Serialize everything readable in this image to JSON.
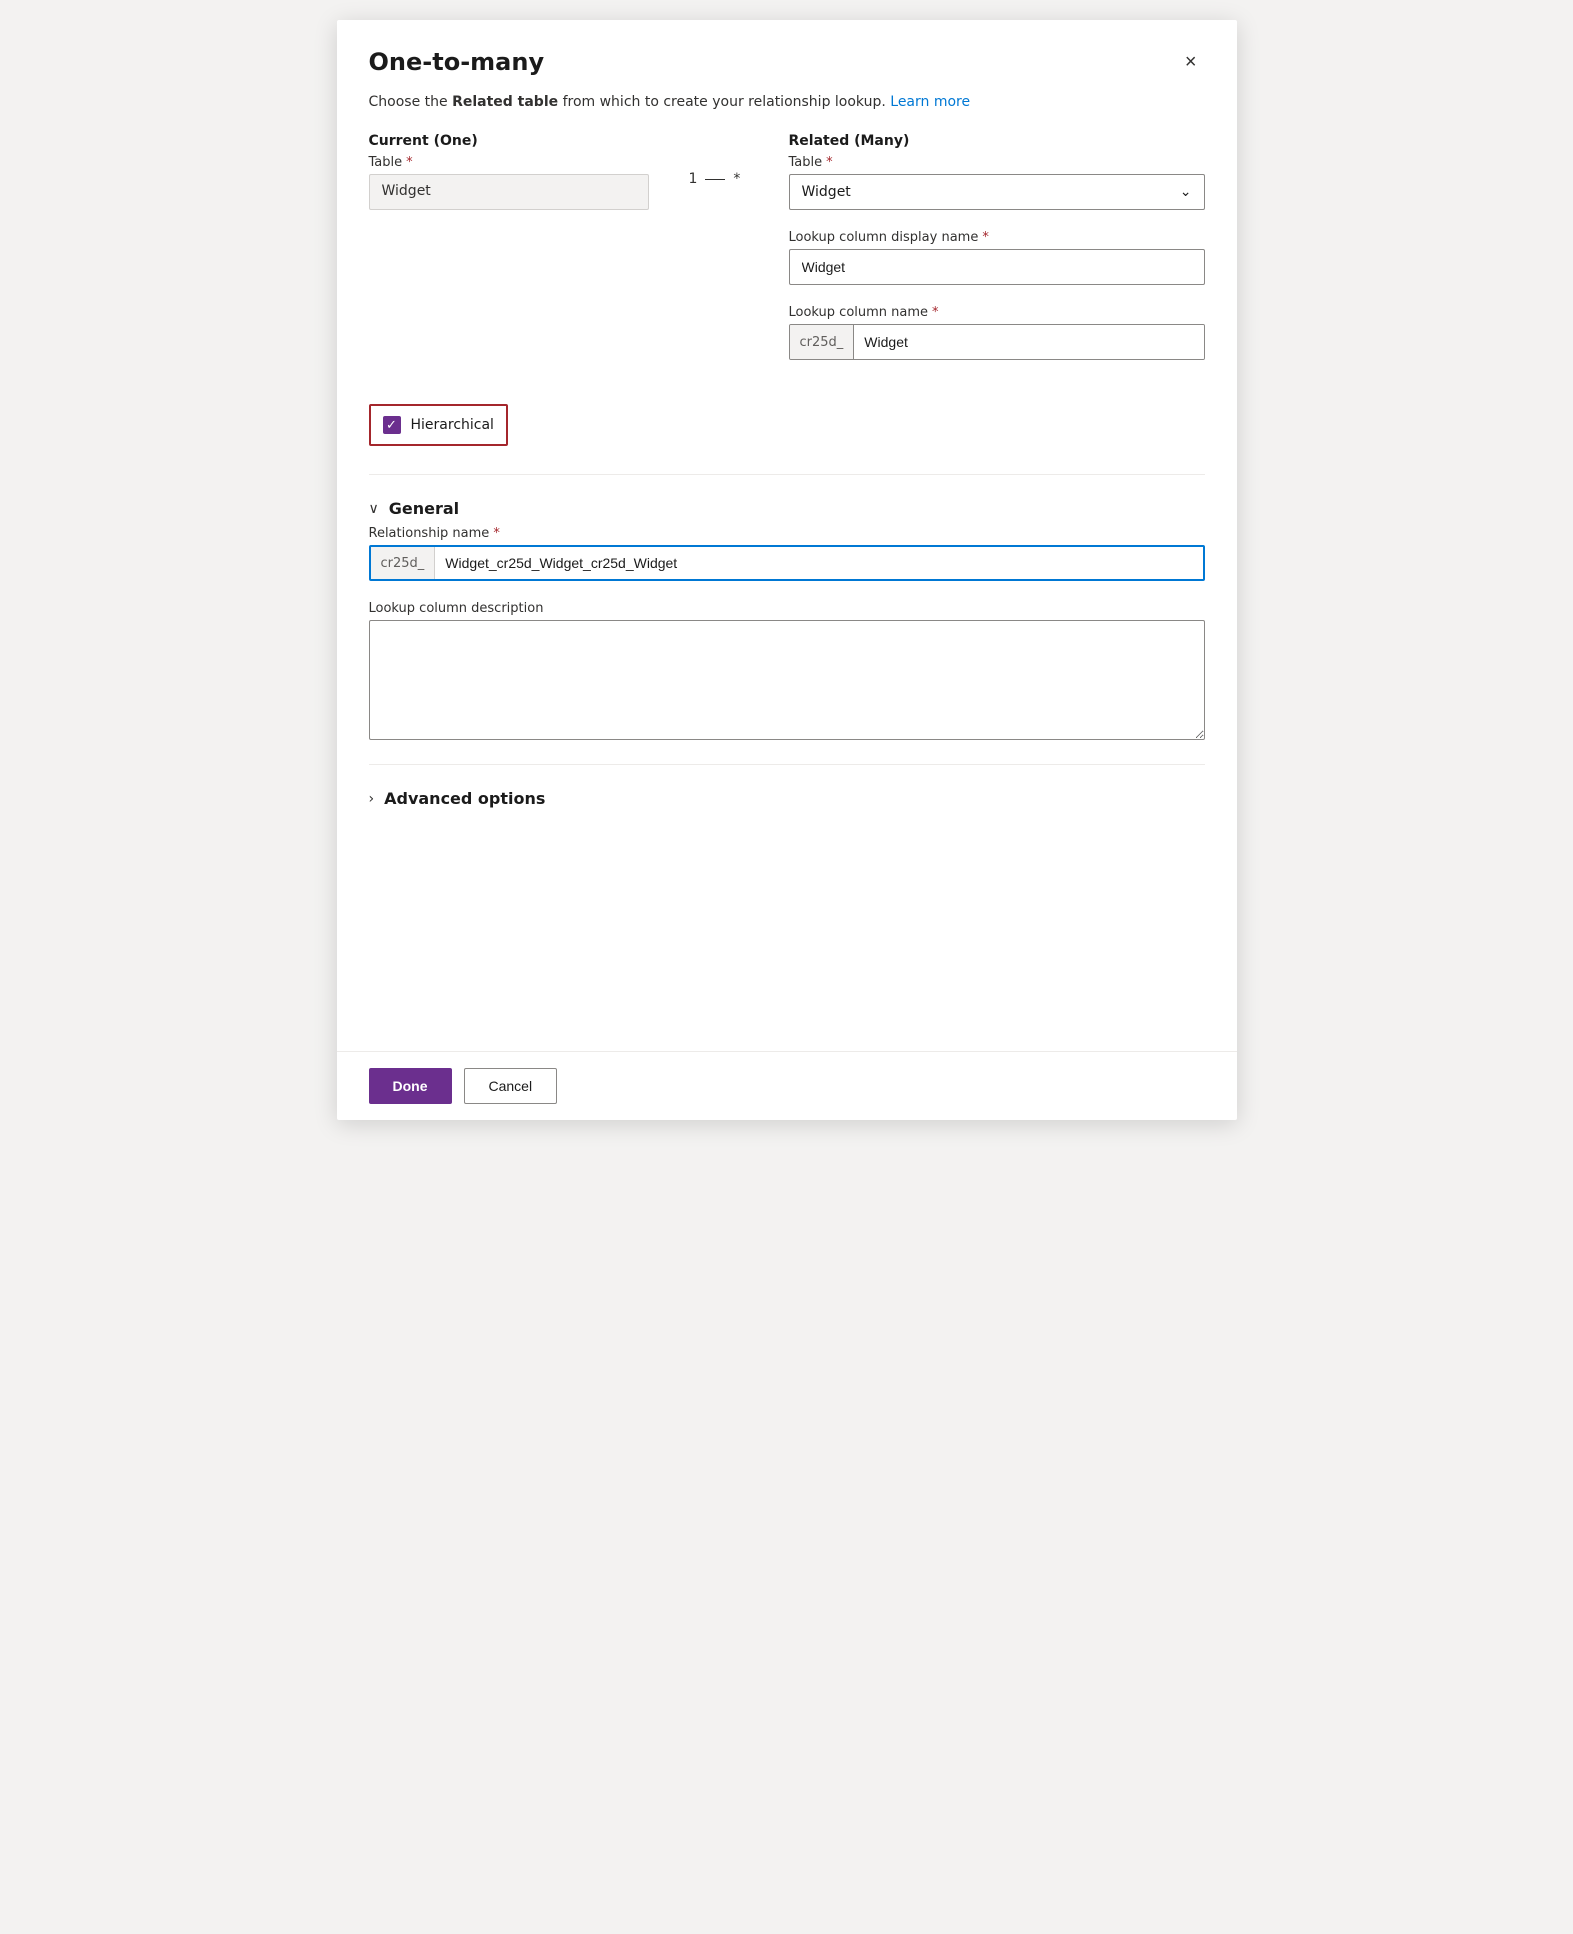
{
  "dialog": {
    "title": "One-to-many",
    "close_label": "×",
    "description_text": "Choose the ",
    "description_bold": "Related table",
    "description_after": " from which to create your relationship lookup.",
    "learn_more": "Learn more"
  },
  "current_section": {
    "label": "Current (One)",
    "table_label": "Table",
    "required": "*",
    "table_value": "Widget"
  },
  "connector": {
    "one": "1",
    "dash": "—",
    "many": "*"
  },
  "related_section": {
    "label": "Related (Many)",
    "table_label": "Table",
    "required": "*",
    "table_value": "Widget",
    "lookup_display_label": "Lookup column display name",
    "lookup_display_required": "*",
    "lookup_display_value": "Widget",
    "lookup_name_label": "Lookup column name",
    "lookup_name_required": "*",
    "lookup_name_prefix": "cr25d_",
    "lookup_name_value": "Widget"
  },
  "hierarchical": {
    "label": "Hierarchical",
    "checked": true
  },
  "general_section": {
    "toggle_label": "General",
    "chevron": "∨",
    "relationship_name_label": "Relationship name",
    "relationship_name_required": "*",
    "relationship_name_prefix": "cr25d_",
    "relationship_name_value": "Widget_cr25d_Widget_cr25d_Widget",
    "lookup_description_label": "Lookup column description",
    "lookup_description_value": ""
  },
  "advanced_section": {
    "toggle_label": "Advanced options",
    "chevron": "›"
  },
  "footer": {
    "done_label": "Done",
    "cancel_label": "Cancel"
  }
}
